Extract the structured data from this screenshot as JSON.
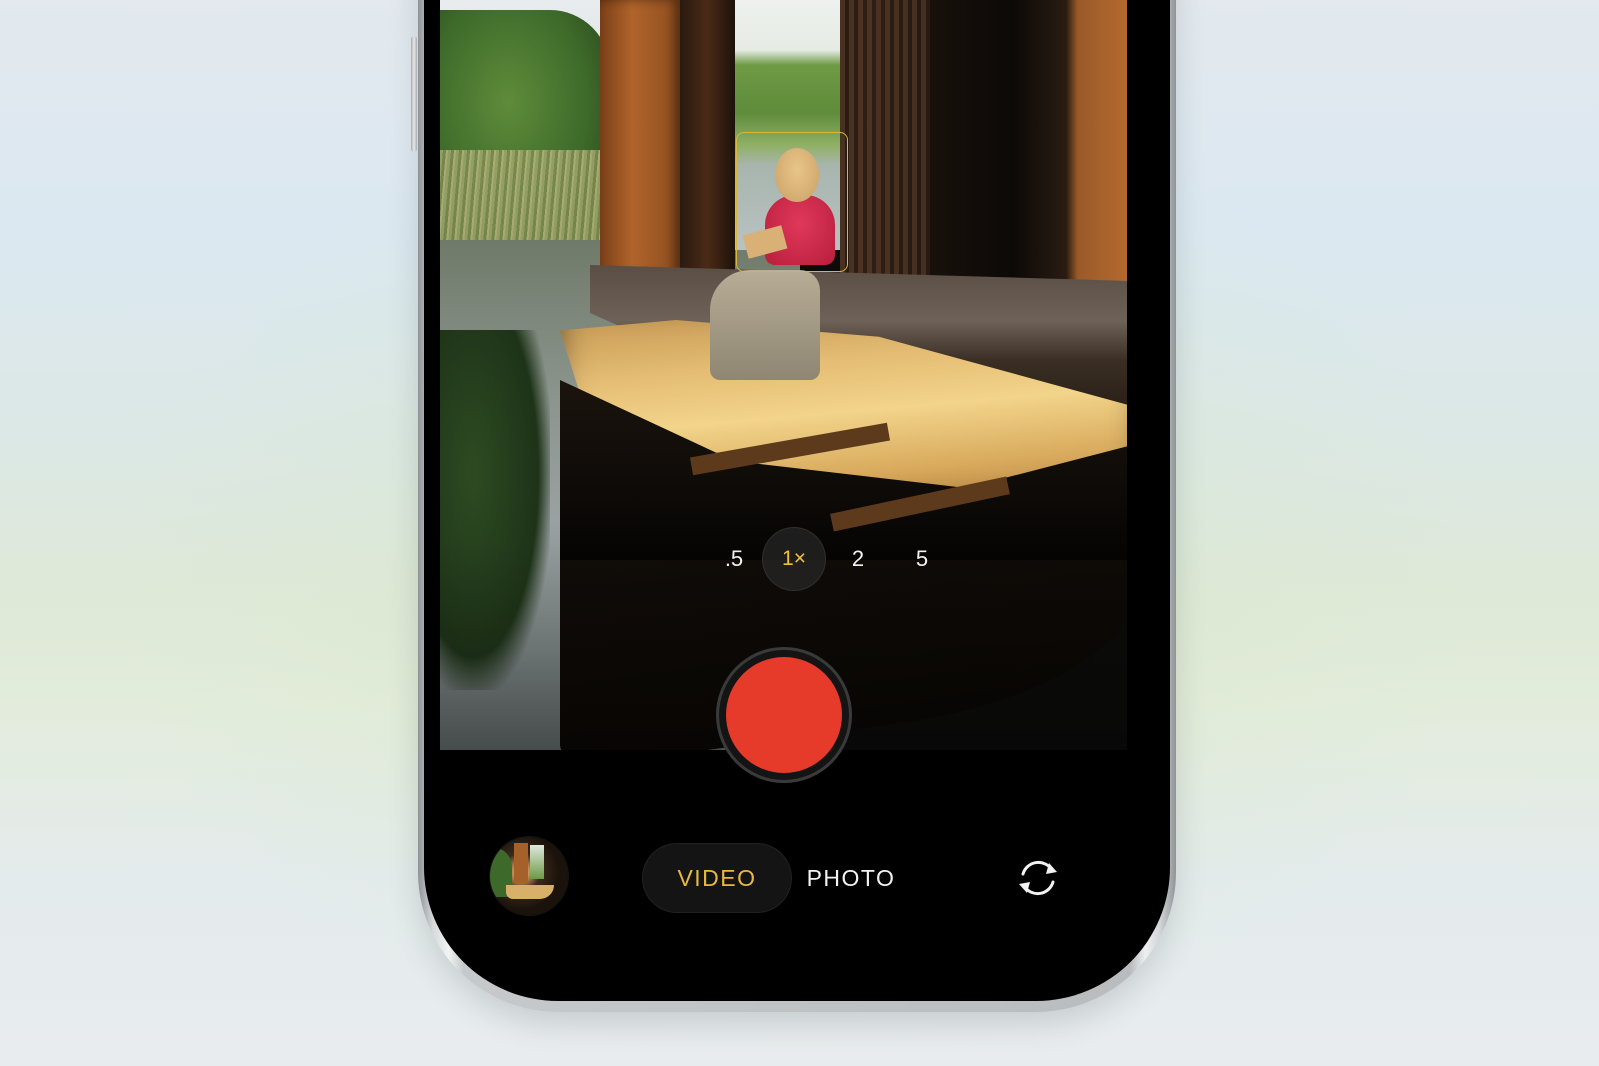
{
  "colors": {
    "accent": "#e8b93c",
    "zoom_active": "#f0c23c",
    "record": "#e63a2a",
    "focus": "#d8b738"
  },
  "camera": {
    "zoom_options": [
      {
        "label": ".5"
      },
      {
        "label": "1×",
        "selected": true
      },
      {
        "label": "2"
      },
      {
        "label": "5"
      }
    ],
    "modes": {
      "video": "VIDEO",
      "photo": "PHOTO",
      "selected": "VIDEO"
    },
    "icons": {
      "shutter": "record-icon",
      "flip": "camera-flip-icon",
      "thumbnail": "last-photo-thumbnail"
    }
  }
}
